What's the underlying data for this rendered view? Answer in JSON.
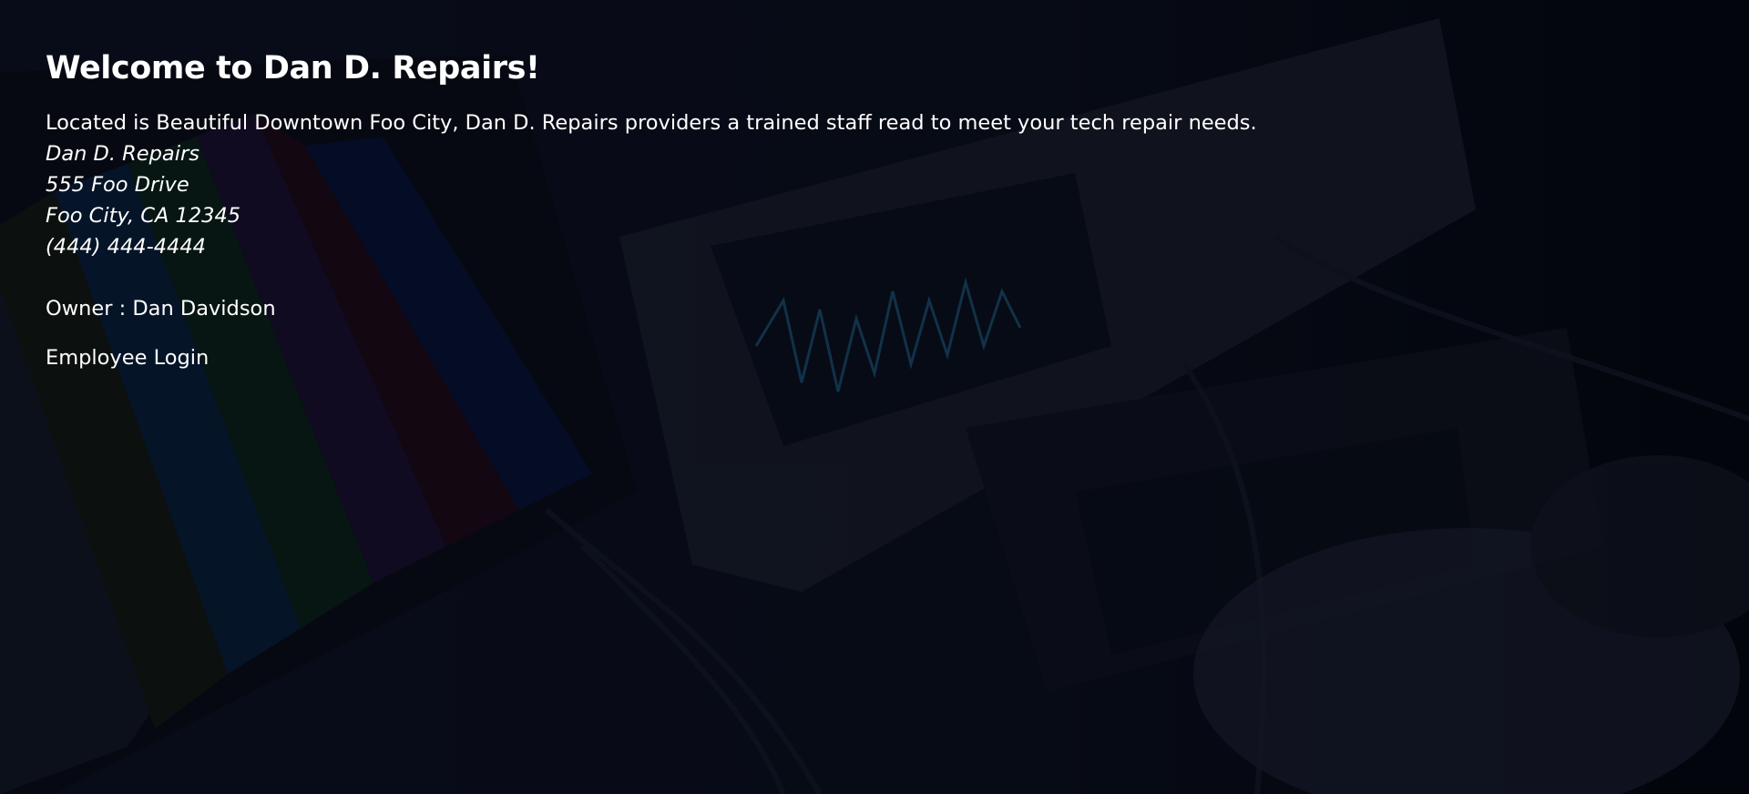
{
  "hero": {
    "title": "Welcome to Dan D. Repairs!",
    "intro": "Located is Beautiful Downtown Foo City, Dan D. Repairs providers a trained staff read to meet your tech repair needs."
  },
  "address": {
    "business_name": "Dan D. Repairs",
    "street": "555 Foo Drive",
    "city_state_zip": "Foo City, CA 12345",
    "phone": "(444) 444-4444"
  },
  "owner": {
    "text": "Owner : Dan Davidson"
  },
  "links": {
    "employee_login": "Employee Login"
  }
}
